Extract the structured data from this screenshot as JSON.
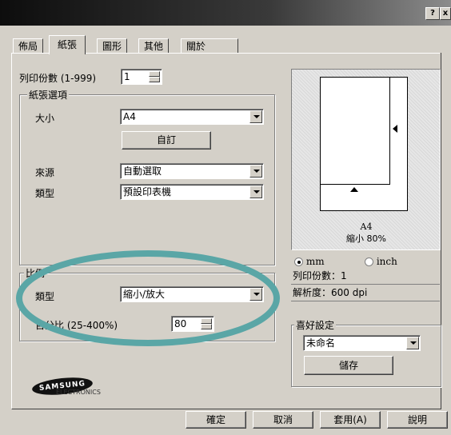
{
  "window": {
    "help_btn": "?",
    "close_btn": "x"
  },
  "tabs": [
    {
      "label": "佈局"
    },
    {
      "label": "紙張",
      "active": true
    },
    {
      "label": "圖形"
    },
    {
      "label": "其他"
    },
    {
      "label": "關於"
    }
  ],
  "copies": {
    "label": "列印份數 (1-999)",
    "value": "1"
  },
  "paper_options": {
    "legend": "紙張選項",
    "size_label": "大小",
    "size_value": "A4",
    "custom_button": "自訂",
    "source_label": "來源",
    "source_value": "自動選取",
    "type_label": "類型",
    "type_value": "預設印表機"
  },
  "scaling": {
    "legend": "比例",
    "type_label": "類型",
    "type_value": "縮小/放大",
    "percent_label": "百分比 (25-400%)",
    "percent_value": "80"
  },
  "preview": {
    "paper": "A4",
    "scale": "縮小 80%"
  },
  "units": {
    "mm": "mm",
    "inch": "inch",
    "selected": "mm"
  },
  "summary": {
    "copies": "列印份數：1",
    "resolution": "解析度：600 dpi"
  },
  "favorites": {
    "legend": "喜好設定",
    "value": "未命名",
    "save_button": "儲存"
  },
  "logo": {
    "brand": "SAMSUNG",
    "sub": "ELECTRONICS"
  },
  "footer": {
    "ok": "確定",
    "cancel": "取消",
    "apply": "套用(A)",
    "help": "說明"
  },
  "colors": {
    "highlight_ellipse": "#5aa6a6"
  }
}
